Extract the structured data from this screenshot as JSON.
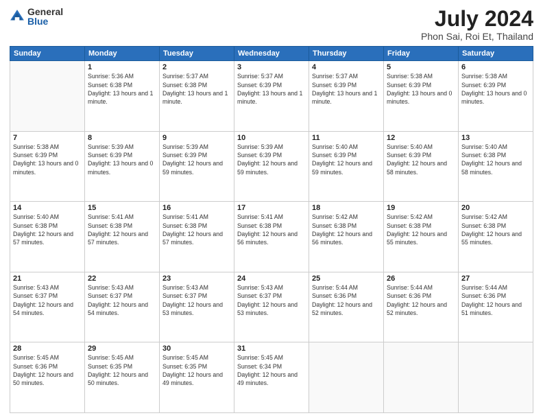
{
  "header": {
    "logo": {
      "general": "General",
      "blue": "Blue"
    },
    "title": "July 2024",
    "location": "Phon Sai, Roi Et, Thailand"
  },
  "days_of_week": [
    "Sunday",
    "Monday",
    "Tuesday",
    "Wednesday",
    "Thursday",
    "Friday",
    "Saturday"
  ],
  "weeks": [
    [
      {
        "day": "",
        "sunrise": "",
        "sunset": "",
        "daylight": ""
      },
      {
        "day": "1",
        "sunrise": "Sunrise: 5:36 AM",
        "sunset": "Sunset: 6:38 PM",
        "daylight": "Daylight: 13 hours and 1 minute."
      },
      {
        "day": "2",
        "sunrise": "Sunrise: 5:37 AM",
        "sunset": "Sunset: 6:38 PM",
        "daylight": "Daylight: 13 hours and 1 minute."
      },
      {
        "day": "3",
        "sunrise": "Sunrise: 5:37 AM",
        "sunset": "Sunset: 6:39 PM",
        "daylight": "Daylight: 13 hours and 1 minute."
      },
      {
        "day": "4",
        "sunrise": "Sunrise: 5:37 AM",
        "sunset": "Sunset: 6:39 PM",
        "daylight": "Daylight: 13 hours and 1 minute."
      },
      {
        "day": "5",
        "sunrise": "Sunrise: 5:38 AM",
        "sunset": "Sunset: 6:39 PM",
        "daylight": "Daylight: 13 hours and 0 minutes."
      },
      {
        "day": "6",
        "sunrise": "Sunrise: 5:38 AM",
        "sunset": "Sunset: 6:39 PM",
        "daylight": "Daylight: 13 hours and 0 minutes."
      }
    ],
    [
      {
        "day": "7",
        "sunrise": "Sunrise: 5:38 AM",
        "sunset": "Sunset: 6:39 PM",
        "daylight": "Daylight: 13 hours and 0 minutes."
      },
      {
        "day": "8",
        "sunrise": "Sunrise: 5:39 AM",
        "sunset": "Sunset: 6:39 PM",
        "daylight": "Daylight: 13 hours and 0 minutes."
      },
      {
        "day": "9",
        "sunrise": "Sunrise: 5:39 AM",
        "sunset": "Sunset: 6:39 PM",
        "daylight": "Daylight: 12 hours and 59 minutes."
      },
      {
        "day": "10",
        "sunrise": "Sunrise: 5:39 AM",
        "sunset": "Sunset: 6:39 PM",
        "daylight": "Daylight: 12 hours and 59 minutes."
      },
      {
        "day": "11",
        "sunrise": "Sunrise: 5:40 AM",
        "sunset": "Sunset: 6:39 PM",
        "daylight": "Daylight: 12 hours and 59 minutes."
      },
      {
        "day": "12",
        "sunrise": "Sunrise: 5:40 AM",
        "sunset": "Sunset: 6:39 PM",
        "daylight": "Daylight: 12 hours and 58 minutes."
      },
      {
        "day": "13",
        "sunrise": "Sunrise: 5:40 AM",
        "sunset": "Sunset: 6:38 PM",
        "daylight": "Daylight: 12 hours and 58 minutes."
      }
    ],
    [
      {
        "day": "14",
        "sunrise": "Sunrise: 5:40 AM",
        "sunset": "Sunset: 6:38 PM",
        "daylight": "Daylight: 12 hours and 57 minutes."
      },
      {
        "day": "15",
        "sunrise": "Sunrise: 5:41 AM",
        "sunset": "Sunset: 6:38 PM",
        "daylight": "Daylight: 12 hours and 57 minutes."
      },
      {
        "day": "16",
        "sunrise": "Sunrise: 5:41 AM",
        "sunset": "Sunset: 6:38 PM",
        "daylight": "Daylight: 12 hours and 57 minutes."
      },
      {
        "day": "17",
        "sunrise": "Sunrise: 5:41 AM",
        "sunset": "Sunset: 6:38 PM",
        "daylight": "Daylight: 12 hours and 56 minutes."
      },
      {
        "day": "18",
        "sunrise": "Sunrise: 5:42 AM",
        "sunset": "Sunset: 6:38 PM",
        "daylight": "Daylight: 12 hours and 56 minutes."
      },
      {
        "day": "19",
        "sunrise": "Sunrise: 5:42 AM",
        "sunset": "Sunset: 6:38 PM",
        "daylight": "Daylight: 12 hours and 55 minutes."
      },
      {
        "day": "20",
        "sunrise": "Sunrise: 5:42 AM",
        "sunset": "Sunset: 6:38 PM",
        "daylight": "Daylight: 12 hours and 55 minutes."
      }
    ],
    [
      {
        "day": "21",
        "sunrise": "Sunrise: 5:43 AM",
        "sunset": "Sunset: 6:37 PM",
        "daylight": "Daylight: 12 hours and 54 minutes."
      },
      {
        "day": "22",
        "sunrise": "Sunrise: 5:43 AM",
        "sunset": "Sunset: 6:37 PM",
        "daylight": "Daylight: 12 hours and 54 minutes."
      },
      {
        "day": "23",
        "sunrise": "Sunrise: 5:43 AM",
        "sunset": "Sunset: 6:37 PM",
        "daylight": "Daylight: 12 hours and 53 minutes."
      },
      {
        "day": "24",
        "sunrise": "Sunrise: 5:43 AM",
        "sunset": "Sunset: 6:37 PM",
        "daylight": "Daylight: 12 hours and 53 minutes."
      },
      {
        "day": "25",
        "sunrise": "Sunrise: 5:44 AM",
        "sunset": "Sunset: 6:36 PM",
        "daylight": "Daylight: 12 hours and 52 minutes."
      },
      {
        "day": "26",
        "sunrise": "Sunrise: 5:44 AM",
        "sunset": "Sunset: 6:36 PM",
        "daylight": "Daylight: 12 hours and 52 minutes."
      },
      {
        "day": "27",
        "sunrise": "Sunrise: 5:44 AM",
        "sunset": "Sunset: 6:36 PM",
        "daylight": "Daylight: 12 hours and 51 minutes."
      }
    ],
    [
      {
        "day": "28",
        "sunrise": "Sunrise: 5:45 AM",
        "sunset": "Sunset: 6:36 PM",
        "daylight": "Daylight: 12 hours and 50 minutes."
      },
      {
        "day": "29",
        "sunrise": "Sunrise: 5:45 AM",
        "sunset": "Sunset: 6:35 PM",
        "daylight": "Daylight: 12 hours and 50 minutes."
      },
      {
        "day": "30",
        "sunrise": "Sunrise: 5:45 AM",
        "sunset": "Sunset: 6:35 PM",
        "daylight": "Daylight: 12 hours and 49 minutes."
      },
      {
        "day": "31",
        "sunrise": "Sunrise: 5:45 AM",
        "sunset": "Sunset: 6:34 PM",
        "daylight": "Daylight: 12 hours and 49 minutes."
      },
      {
        "day": "",
        "sunrise": "",
        "sunset": "",
        "daylight": ""
      },
      {
        "day": "",
        "sunrise": "",
        "sunset": "",
        "daylight": ""
      },
      {
        "day": "",
        "sunrise": "",
        "sunset": "",
        "daylight": ""
      }
    ]
  ]
}
